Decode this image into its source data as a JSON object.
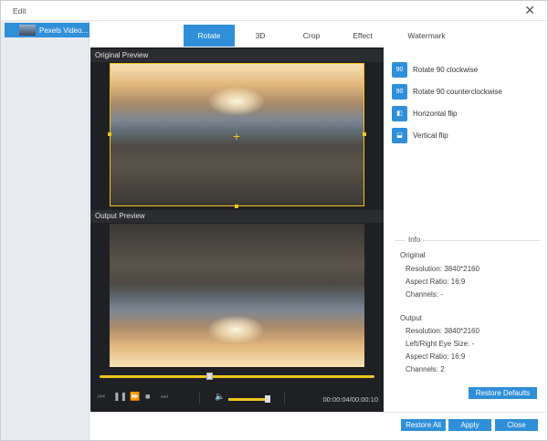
{
  "window": {
    "title": "Edit",
    "close_symbol": "✕"
  },
  "sidebar": {
    "items": [
      {
        "label": "Pexels Video..."
      }
    ]
  },
  "tabs": [
    {
      "label": "Rotate",
      "active": true
    },
    {
      "label": "3D",
      "active": false
    },
    {
      "label": "Crop",
      "active": false
    },
    {
      "label": "Effect",
      "active": false
    },
    {
      "label": "Watermark",
      "active": false
    }
  ],
  "preview": {
    "original_label": "Original Preview",
    "output_label": "Output Preview",
    "progress_fraction": 0.4,
    "volume_fraction": 0.95,
    "time": "00:00:04/00:00:10"
  },
  "operations": [
    {
      "label": "Rotate 90 clockwise",
      "icon": "rotate-clockwise-icon",
      "glyph": "90"
    },
    {
      "label": "Rotate 90 counterclockwise",
      "icon": "rotate-counterclockwise-icon",
      "glyph": "90"
    },
    {
      "label": "Horizontal flip",
      "icon": "horizontal-flip-icon",
      "glyph": "◧"
    },
    {
      "label": "Vertical flip",
      "icon": "vertical-flip-icon",
      "glyph": "⬓"
    }
  ],
  "info": {
    "title": "Info",
    "original": {
      "heading": "Original",
      "resolution": "Resolution: 3840*2160",
      "aspect_ratio": "Aspect Ratio: 16:9",
      "channels": "Channels: -"
    },
    "output": {
      "heading": "Output",
      "resolution": "Resolution: 3840*2160",
      "eye_size": "Left/Right Eye Size: -",
      "aspect_ratio": "Aspect Ratio: 16:9",
      "channels": "Channels: 2"
    }
  },
  "buttons": {
    "restore_defaults": "Restore Defaults",
    "restore_all": "Restore All",
    "apply": "Apply",
    "close": "Close"
  },
  "colors": {
    "accent": "#2f8fd8",
    "highlight": "#f0c420"
  }
}
